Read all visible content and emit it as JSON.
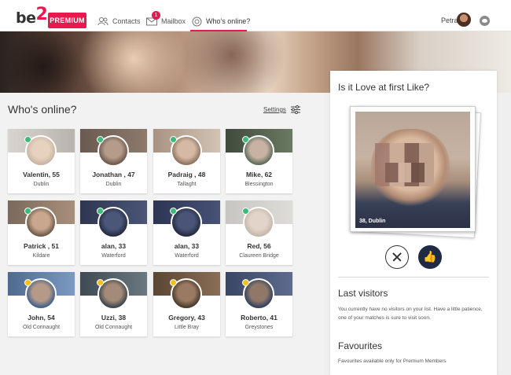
{
  "brand": {
    "logo_text": "be",
    "logo_num": "2"
  },
  "nav": {
    "premium_label": "PREMIUM",
    "contacts_label": "Contacts",
    "mailbox_label": "Mailbox",
    "mailbox_badge": "1",
    "online_label": "Who's online?",
    "user_name": "Petra"
  },
  "main": {
    "title": "Who's online?",
    "settings_label": "Settings",
    "profiles": [
      {
        "name": "Valentin, 55",
        "city": "Dublin",
        "status": "online"
      },
      {
        "name": "Jonathan , 47",
        "city": "Dublin",
        "status": "online"
      },
      {
        "name": "Padraig , 48",
        "city": "Tallaght",
        "status": "online"
      },
      {
        "name": "Mike, 62",
        "city": "Blessington",
        "status": "online"
      },
      {
        "name": "Patrick , 51",
        "city": "Kildare",
        "status": "online"
      },
      {
        "name": "alan, 33",
        "city": "Waterford",
        "status": "online"
      },
      {
        "name": "alan, 33",
        "city": "Waterford",
        "status": "online"
      },
      {
        "name": "Red, 56",
        "city": "Claureen Bridge",
        "status": "online"
      },
      {
        "name": "John, 54",
        "city": "Old Connaught",
        "status": "away"
      },
      {
        "name": "Uzzi, 38",
        "city": "Old Connaught",
        "status": "away"
      },
      {
        "name": "Gregory, 43",
        "city": "Little Bray",
        "status": "away"
      },
      {
        "name": "Roberto, 41",
        "city": "Greystones",
        "status": "away"
      }
    ]
  },
  "side": {
    "like_title": "Is it Love at first Like?",
    "photo_caption": "38, Dublin",
    "last_visitors_title": "Last visitors",
    "last_visitors_text": "You currently have no visitors on your list. Have a little patience, one of your matches is sure to visit soon.",
    "favourites_title": "Favourites",
    "favourites_text": "Favourites available only for Premium Members"
  },
  "colors": {
    "brand": "#e8174e",
    "online": "#3dbb7a",
    "away": "#f2c21b",
    "like_button": "#1f2a44"
  }
}
